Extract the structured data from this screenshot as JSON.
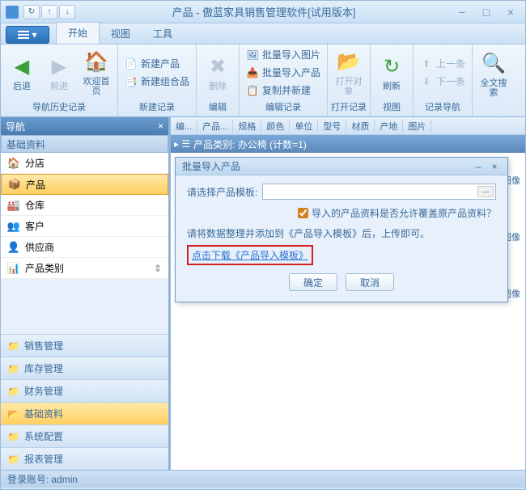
{
  "titlebar": {
    "title": "产品 - 傲蓝家具销售管理软件[试用版本]"
  },
  "ribbon_tabs": {
    "start": "开始",
    "view": "视图",
    "tools": "工具"
  },
  "ribbon": {
    "back": "后退",
    "forward": "前进",
    "home": "欢迎首页",
    "history_label": "导航历史记录",
    "new_product": "新建产品",
    "new_combo": "新建组合品",
    "new_record_label": "新建记录",
    "delete": "删除",
    "edit_label": "编辑",
    "import_img": "批量导入图片",
    "import_prod": "批量导入产品",
    "copy_new": "复制并新建",
    "edit_record_label": "编辑记录",
    "open_obj": "打开对象",
    "open_record_label": "打开记录",
    "refresh": "刷新",
    "view_label": "视图",
    "prev": "上一条",
    "next": "下一条",
    "nav_label": "记录导航",
    "search": "全文搜索"
  },
  "sidebar": {
    "header": "导航",
    "category": "基础资料",
    "items": [
      {
        "icon": "🏠",
        "label": "分店"
      },
      {
        "icon": "📦",
        "label": "产品"
      },
      {
        "icon": "🏭",
        "label": "仓库"
      },
      {
        "icon": "👥",
        "label": "客户"
      },
      {
        "icon": "👤",
        "label": "供应商"
      },
      {
        "icon": "📊",
        "label": "产品类别"
      }
    ],
    "groups": [
      "销售管理",
      "库存管理",
      "财务管理",
      "基础资料",
      "系统配置",
      "报表管理"
    ]
  },
  "breadcrumb": [
    "编...",
    "产品...",
    "规格",
    "颜色",
    "单位",
    "型号",
    "材质",
    "产地",
    "图片"
  ],
  "category_bar": "产品类别: 办公椅 (计数=1)",
  "image_label": "图像",
  "dialog": {
    "title": "批量导入产品",
    "template_label": "请选择产品模板:",
    "browse": "···",
    "checkbox_label": "导入的产品资料是否允许覆盖原产品资料？",
    "hint": "请将数据整理并添加到《产品导入模板》后，上传即可。",
    "link": "点击下载《产品导入模板》",
    "ok": "确定",
    "cancel": "取消"
  },
  "statusbar": {
    "account_label": "登录账号:",
    "account": "admin"
  }
}
